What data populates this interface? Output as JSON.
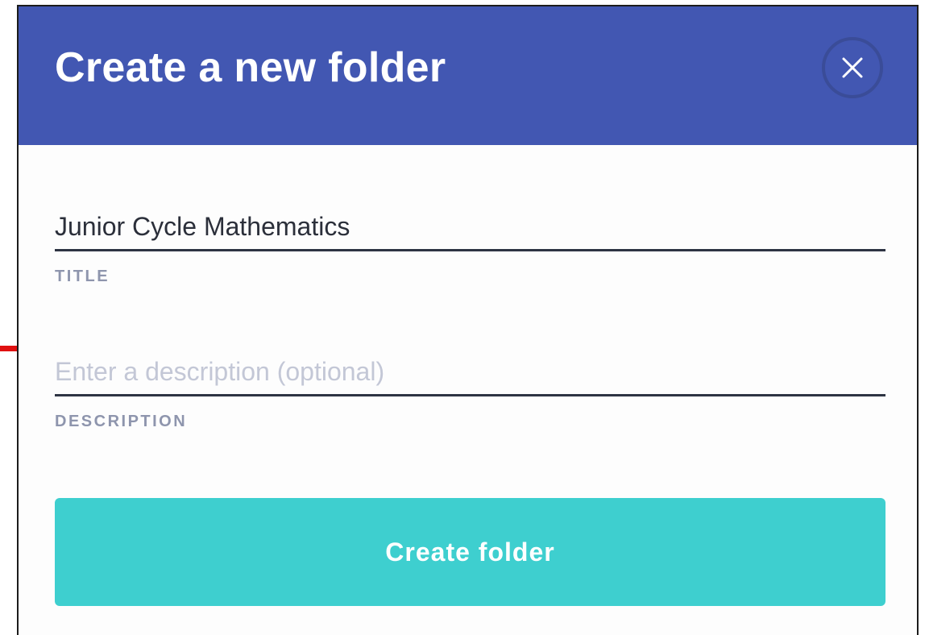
{
  "dialog": {
    "title": "Create a new folder",
    "close_icon": "close-icon",
    "header_color": "#4257b2"
  },
  "fields": {
    "title": {
      "value": "Junior Cycle Mathematics",
      "label": "TITLE"
    },
    "description": {
      "value": "",
      "placeholder": "Enter a description (optional)",
      "label": "DESCRIPTION"
    }
  },
  "actions": {
    "submit_label": "Create folder",
    "submit_color": "#3ecfcf"
  }
}
